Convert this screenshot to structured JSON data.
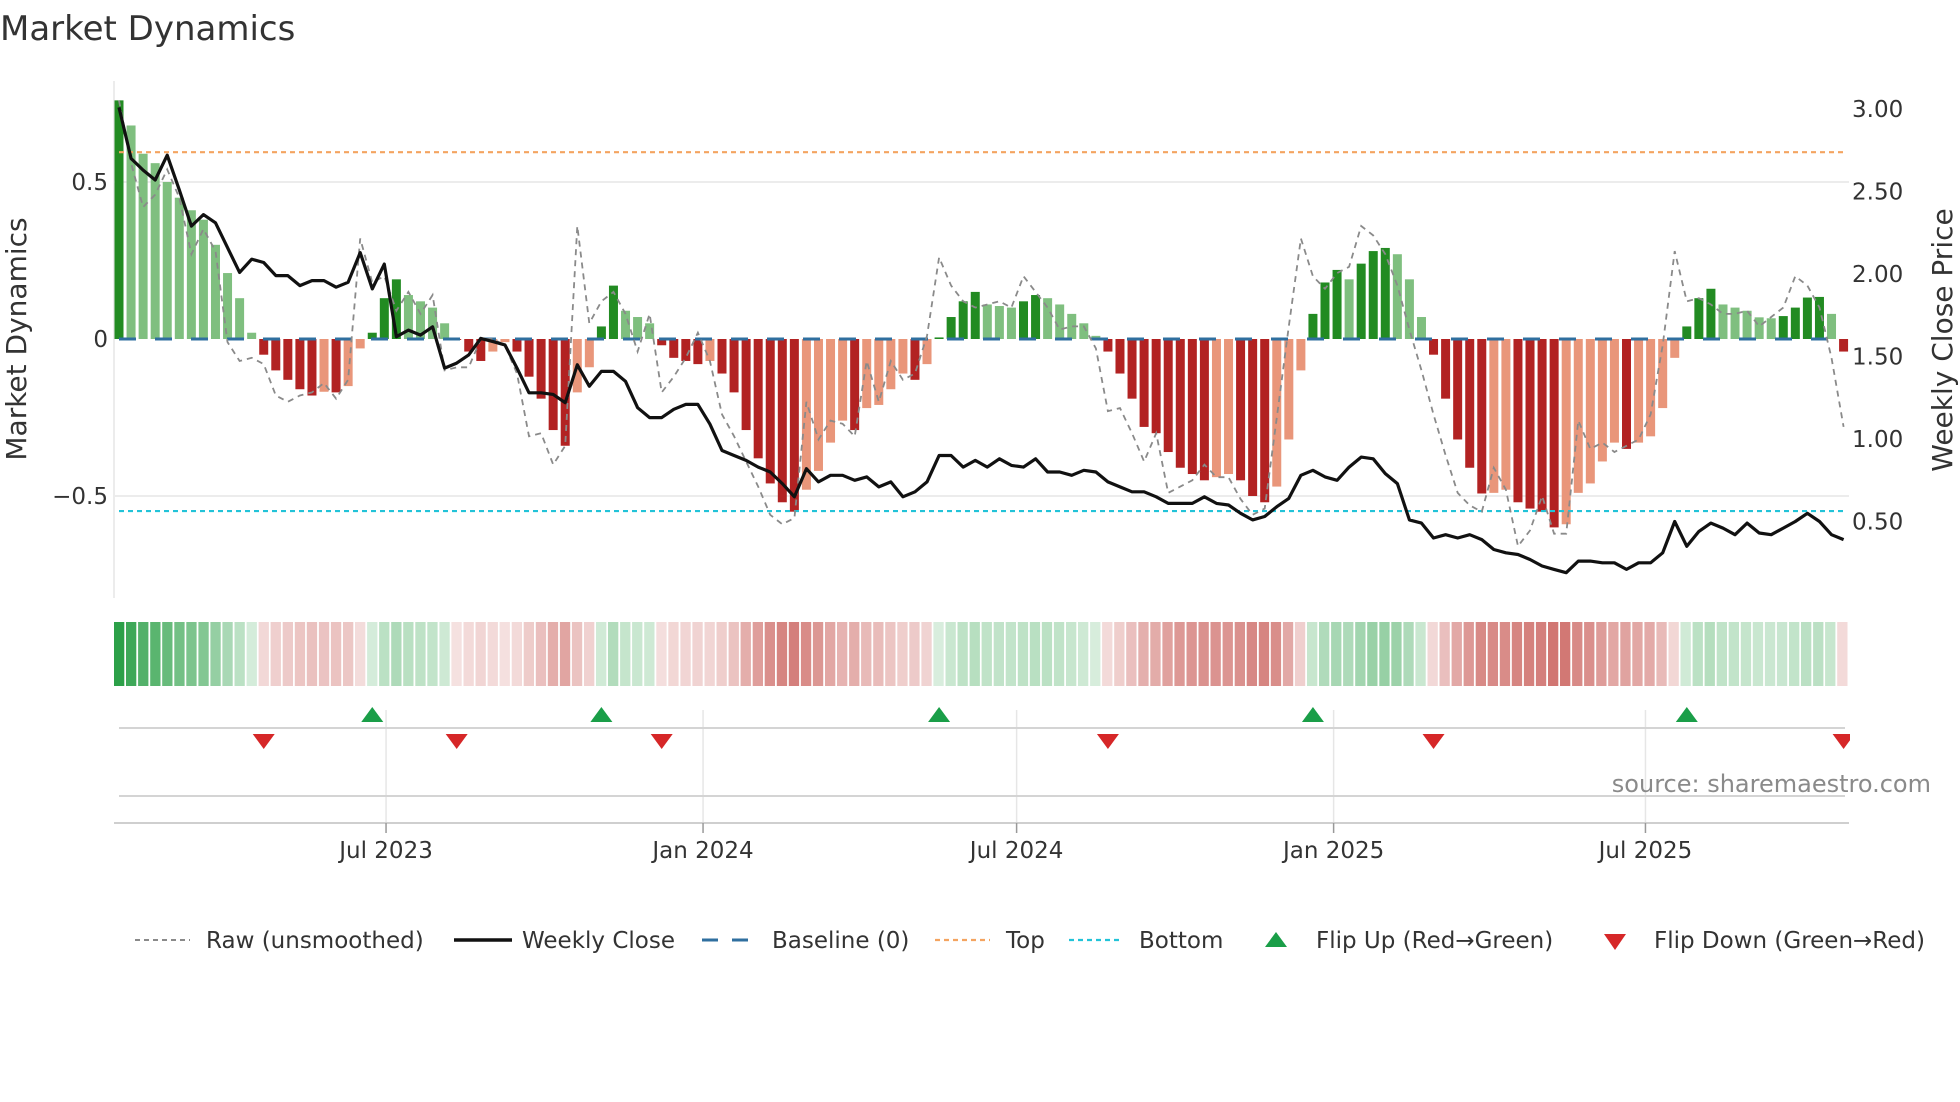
{
  "chart_data": {
    "type": "bar",
    "title": "Market Dynamics",
    "start_date": "2023-01-27",
    "frequency": "weekly",
    "ylabel": "Market Dynamics",
    "ylabel_right": "Weekly Close Price",
    "xlabel": "",
    "ylim": [
      -0.825,
      0.822
    ],
    "ylim_right": [
      0.036,
      3.17
    ],
    "grid": true,
    "yticks": [
      {
        "value": 0.5,
        "label": "0.5"
      },
      {
        "value": 0,
        "label": "0"
      },
      {
        "value": -0.5,
        "label": "−0.5"
      }
    ],
    "yticks_right": [
      {
        "value": 3.0,
        "label": "3.00"
      },
      {
        "value": 2.5,
        "label": "2.50"
      },
      {
        "value": 2.0,
        "label": "2.00"
      },
      {
        "value": 1.5,
        "label": "1.50"
      },
      {
        "value": 1.0,
        "label": "1.00"
      },
      {
        "value": 0.5,
        "label": "0.50"
      }
    ],
    "xticks": [
      {
        "date": "2023-07-01",
        "label": "Jul 2023"
      },
      {
        "date": "2024-01-01",
        "label": "Jan 2024"
      },
      {
        "date": "2024-07-01",
        "label": "Jul 2024"
      },
      {
        "date": "2025-01-01",
        "label": "Jan 2025"
      },
      {
        "date": "2025-07-01",
        "label": "Jul 2025"
      }
    ],
    "baseline": 0,
    "top": 0.595,
    "bottom": -0.548,
    "series": [
      {
        "name": "Market Dynamics",
        "values": [
          0.76,
          0.68,
          0.59,
          0.56,
          0.5,
          0.45,
          0.41,
          0.38,
          0.3,
          0.21,
          0.13,
          0.02,
          -0.05,
          -0.1,
          -0.13,
          -0.16,
          -0.18,
          -0.168,
          -0.17,
          -0.15,
          -0.03,
          0.02,
          0.13,
          0.19,
          0.14,
          0.12,
          0.1,
          0.05,
          -0.003,
          -0.04,
          -0.07,
          -0.04,
          -0.01,
          -0.04,
          -0.12,
          -0.19,
          -0.29,
          -0.34,
          -0.17,
          -0.09,
          0.04,
          0.17,
          0.09,
          0.07,
          0.05,
          -0.02,
          -0.06,
          -0.07,
          -0.08,
          -0.07,
          -0.11,
          -0.17,
          -0.29,
          -0.38,
          -0.46,
          -0.52,
          -0.55,
          -0.48,
          -0.42,
          -0.33,
          -0.26,
          -0.29,
          -0.22,
          -0.21,
          -0.16,
          -0.11,
          -0.13,
          -0.08,
          0.005,
          0.07,
          0.12,
          0.15,
          0.11,
          0.105,
          0.1,
          0.12,
          0.14,
          0.13,
          0.11,
          0.08,
          0.05,
          0.01,
          -0.04,
          -0.11,
          -0.19,
          -0.28,
          -0.3,
          -0.36,
          -0.41,
          -0.43,
          -0.45,
          -0.44,
          -0.43,
          -0.45,
          -0.5,
          -0.52,
          -0.47,
          -0.32,
          -0.1,
          0.08,
          0.18,
          0.22,
          0.19,
          0.24,
          0.28,
          0.29,
          0.27,
          0.19,
          0.07,
          -0.05,
          -0.19,
          -0.32,
          -0.41,
          -0.492,
          -0.49,
          -0.48,
          -0.52,
          -0.54,
          -0.55,
          -0.6,
          -0.59,
          -0.49,
          -0.46,
          -0.39,
          -0.33,
          -0.35,
          -0.33,
          -0.31,
          -0.22,
          -0.06,
          0.04,
          0.13,
          0.16,
          0.11,
          0.1,
          0.09,
          0.069,
          0.066,
          0.073,
          0.1,
          0.132,
          0.134,
          0.08,
          -0.04
        ]
      },
      {
        "name": "Raw (unsmoothed)",
        "values": [
          0.76,
          0.56,
          0.42,
          0.46,
          0.54,
          0.45,
          0.27,
          0.35,
          0.28,
          -0.01,
          -0.07,
          -0.06,
          -0.08,
          -0.18,
          -0.2,
          -0.18,
          -0.17,
          -0.14,
          -0.19,
          -0.13,
          0.32,
          0.18,
          0.2,
          0.09,
          0.15,
          0.08,
          0.14,
          -0.1,
          -0.09,
          -0.09,
          0.0,
          0.0,
          -0.02,
          -0.11,
          -0.31,
          -0.3,
          -0.4,
          -0.34,
          0.36,
          0.05,
          0.12,
          0.15,
          0.08,
          -0.04,
          0.08,
          -0.17,
          -0.12,
          -0.06,
          0.02,
          -0.07,
          -0.24,
          -0.31,
          -0.39,
          -0.47,
          -0.56,
          -0.59,
          -0.57,
          -0.2,
          -0.32,
          -0.26,
          -0.27,
          -0.31,
          -0.07,
          -0.2,
          -0.07,
          -0.13,
          -0.11,
          0.01,
          0.26,
          0.17,
          0.12,
          0.1,
          0.11,
          0.12,
          0.1,
          0.2,
          0.15,
          0.1,
          0.03,
          0.04,
          0.04,
          -0.03,
          -0.23,
          -0.22,
          -0.3,
          -0.39,
          -0.3,
          -0.49,
          -0.47,
          -0.45,
          -0.4,
          -0.44,
          -0.44,
          -0.51,
          -0.56,
          -0.54,
          -0.25,
          0.04,
          0.32,
          0.2,
          0.16,
          0.21,
          0.23,
          0.36,
          0.33,
          0.27,
          0.17,
          0.03,
          -0.1,
          -0.24,
          -0.37,
          -0.49,
          -0.53,
          -0.55,
          -0.41,
          -0.48,
          -0.66,
          -0.61,
          -0.5,
          -0.62,
          -0.62,
          -0.26,
          -0.35,
          -0.33,
          -0.36,
          -0.34,
          -0.32,
          -0.24,
          -0.02,
          0.28,
          0.12,
          0.13,
          0.11,
          0.08,
          0.08,
          0.09,
          0.04,
          0.07,
          0.1,
          0.2,
          0.17,
          0.1,
          -0.06,
          -0.28
        ]
      },
      {
        "name": "Weekly Close",
        "axis": "right",
        "values": [
          3.01,
          2.7,
          2.63,
          2.57,
          2.72,
          2.51,
          2.29,
          2.36,
          2.31,
          2.16,
          2.01,
          2.09,
          2.07,
          1.99,
          1.99,
          1.93,
          1.96,
          1.96,
          1.92,
          1.95,
          2.13,
          1.91,
          2.06,
          1.62,
          1.66,
          1.63,
          1.68,
          1.43,
          1.46,
          1.51,
          1.61,
          1.59,
          1.57,
          1.43,
          1.28,
          1.28,
          1.27,
          1.22,
          1.45,
          1.32,
          1.41,
          1.41,
          1.35,
          1.19,
          1.13,
          1.13,
          1.18,
          1.21,
          1.21,
          1.09,
          0.93,
          0.9,
          0.87,
          0.83,
          0.8,
          0.73,
          0.65,
          0.82,
          0.74,
          0.78,
          0.78,
          0.75,
          0.77,
          0.71,
          0.74,
          0.65,
          0.68,
          0.74,
          0.9,
          0.9,
          0.83,
          0.87,
          0.83,
          0.88,
          0.84,
          0.83,
          0.88,
          0.8,
          0.8,
          0.78,
          0.81,
          0.8,
          0.74,
          0.71,
          0.68,
          0.68,
          0.65,
          0.61,
          0.61,
          0.61,
          0.65,
          0.61,
          0.6,
          0.55,
          0.51,
          0.53,
          0.59,
          0.64,
          0.78,
          0.81,
          0.77,
          0.75,
          0.83,
          0.89,
          0.88,
          0.79,
          0.73,
          0.51,
          0.49,
          0.4,
          0.42,
          0.4,
          0.42,
          0.39,
          0.33,
          0.31,
          0.3,
          0.27,
          0.23,
          0.21,
          0.19,
          0.26,
          0.26,
          0.25,
          0.25,
          0.21,
          0.25,
          0.25,
          0.31,
          0.5,
          0.35,
          0.44,
          0.49,
          0.46,
          0.42,
          0.49,
          0.43,
          0.42,
          0.46,
          0.5,
          0.55,
          0.5,
          0.42,
          0.39
        ]
      }
    ],
    "legend": {
      "position": "bottom",
      "items": [
        {
          "key": "raw",
          "label": "Raw (unsmoothed)"
        },
        {
          "key": "close",
          "label": "Weekly Close"
        },
        {
          "key": "baseline",
          "label": "Baseline (0)"
        },
        {
          "key": "top",
          "label": "Top"
        },
        {
          "key": "bottom",
          "label": "Bottom"
        },
        {
          "key": "flip_up",
          "label": "Flip Up (Red→Green)"
        },
        {
          "key": "flip_down",
          "label": "Flip Down (Green→Red)"
        }
      ]
    },
    "colors": {
      "pos_strong": "#228b22",
      "pos_weak": "#7fbf7f",
      "neg_strong": "#b22222",
      "neg_weak": "#e9967a",
      "raw": "#8a8a8a",
      "close": "#111111",
      "baseline": "#2f6f9f",
      "top": "#f4a460",
      "bottom": "#22c3d8",
      "flip_up": "#1a9e48",
      "flip_down": "#d62728",
      "regime_pos": "#2ca048",
      "regime_neg": "#c85a55"
    }
  },
  "source": "source: sharemaestro.com"
}
